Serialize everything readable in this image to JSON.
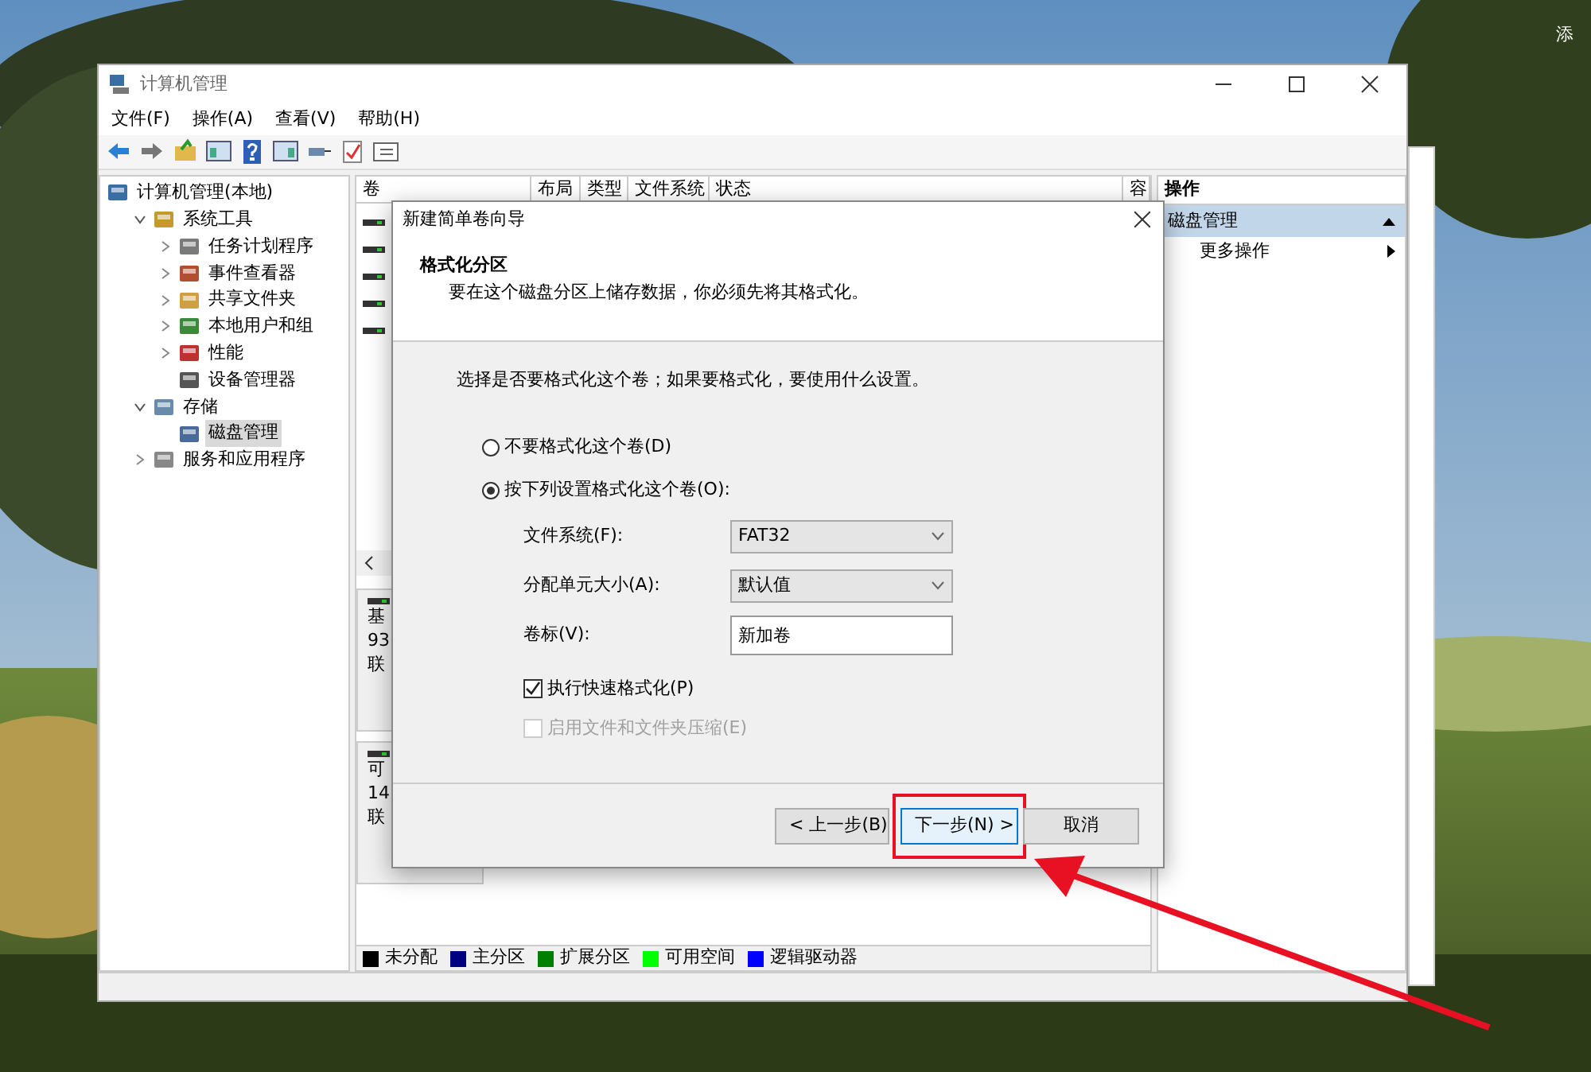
{
  "desktop": {
    "corner_label": "添"
  },
  "window": {
    "title": "计算机管理",
    "menu": [
      "文件(F)",
      "操作(A)",
      "查看(V)",
      "帮助(H)"
    ]
  },
  "tree": [
    {
      "label": "计算机管理(本地)",
      "selected": false,
      "children": [
        {
          "label": "系统工具",
          "selected": false,
          "expanded": true,
          "children": [
            {
              "label": "任务计划程序",
              "selected": false,
              "expanded": false
            },
            {
              "label": "事件查看器",
              "selected": false,
              "expanded": false
            },
            {
              "label": "共享文件夹",
              "selected": false,
              "expanded": false
            },
            {
              "label": "本地用户和组",
              "selected": false,
              "expanded": false
            },
            {
              "label": "性能",
              "selected": false,
              "expanded": false
            },
            {
              "label": "设备管理器",
              "selected": false
            }
          ]
        },
        {
          "label": "存储",
          "selected": false,
          "expanded": true,
          "children": [
            {
              "label": "磁盘管理",
              "selected": true
            }
          ]
        },
        {
          "label": "服务和应用程序",
          "selected": false,
          "expanded": false
        }
      ]
    }
  ],
  "volume_list": {
    "columns": [
      "卷",
      "布局",
      "类型",
      "文件系统",
      "状态",
      "容"
    ]
  },
  "disks": [
    {
      "lines": [
        "基",
        "93",
        "联"
      ]
    },
    {
      "lines": [
        "可",
        "14",
        "联"
      ]
    }
  ],
  "legend": [
    {
      "label": "未分配",
      "color": "#000000"
    },
    {
      "label": "主分区",
      "color": "#000080"
    },
    {
      "label": "扩展分区",
      "color": "#008000"
    },
    {
      "label": "可用空间",
      "color": "#00ff00"
    },
    {
      "label": "逻辑驱动器",
      "color": "#0000ff"
    }
  ],
  "actions": {
    "header": "操作",
    "section": "磁盘管理",
    "items": [
      "更多操作"
    ]
  },
  "dialog": {
    "title": "新建简单卷向导",
    "heading": "格式化分区",
    "subtitle": "要在这个磁盘分区上储存数据，你必须先将其格式化。",
    "prompt": "选择是否要格式化这个卷；如果要格式化，要使用什么设置。",
    "options": [
      {
        "label": "不要格式化这个卷(D)",
        "selected": false
      },
      {
        "label": "按下列设置格式化这个卷(O):",
        "selected": true
      }
    ],
    "fields": [
      {
        "kind": "select",
        "label": "文件系统(F):",
        "value": "FAT32"
      },
      {
        "kind": "select",
        "label": "分配单元大小(A):",
        "value": "默认值"
      },
      {
        "kind": "text",
        "label": "卷标(V):",
        "value": "新加卷"
      }
    ],
    "checks": [
      {
        "label": "执行快速格式化(P)",
        "checked": true,
        "disabled": false
      },
      {
        "label": "启用文件和文件夹压缩(E)",
        "checked": false,
        "disabled": true
      }
    ],
    "buttons": [
      {
        "label": "< 上一步(B)",
        "focused": false,
        "highlighted": false
      },
      {
        "label": "下一步(N) >",
        "focused": true,
        "highlighted": true
      },
      {
        "label": "取消",
        "focused": false,
        "highlighted": false
      }
    ]
  }
}
